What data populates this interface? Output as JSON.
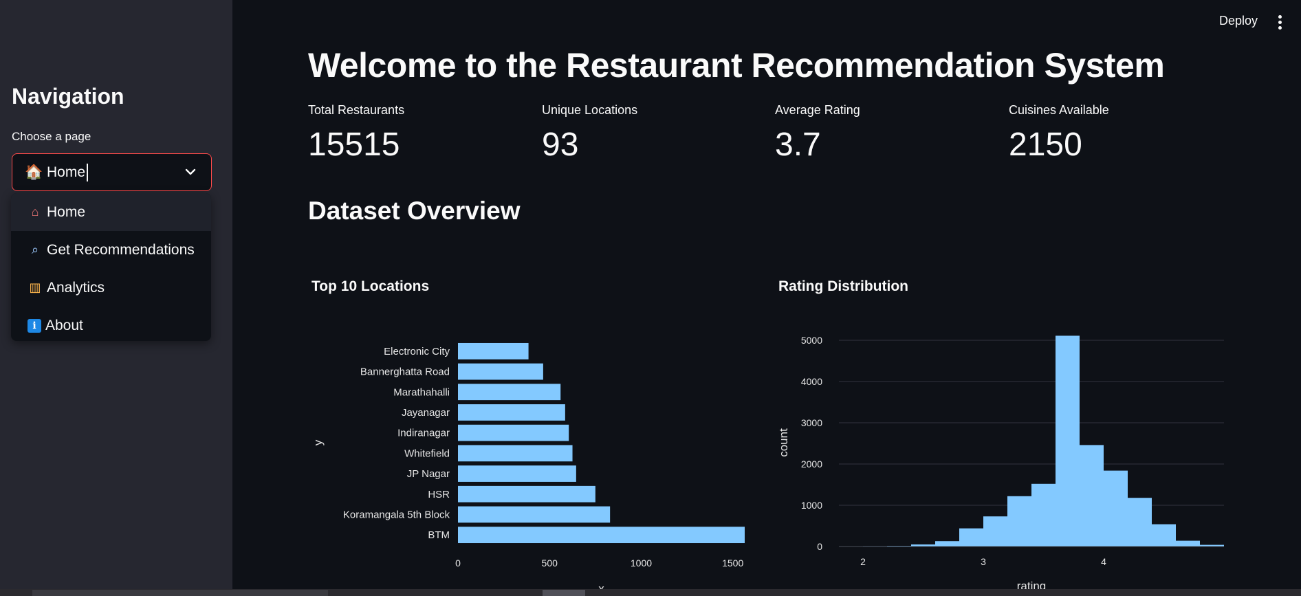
{
  "header": {
    "deploy_label": "Deploy"
  },
  "sidebar": {
    "title": "Navigation",
    "select_label": "Choose a page",
    "selected_value": "🏠 Home",
    "options": [
      {
        "icon": "house-icon",
        "label": "Home"
      },
      {
        "icon": "magnifier-icon",
        "label": "Get Recommendations"
      },
      {
        "icon": "bar-chart-icon",
        "label": "Analytics"
      },
      {
        "icon": "info-icon",
        "label": "About"
      }
    ]
  },
  "main": {
    "title": "Welcome to the Restaurant Recommendation System",
    "metrics": [
      {
        "label": "Total Restaurants",
        "value": "15515"
      },
      {
        "label": "Unique Locations",
        "value": "93"
      },
      {
        "label": "Average Rating",
        "value": "3.7"
      },
      {
        "label": "Cuisines Available",
        "value": "2150"
      }
    ],
    "section_title": "Dataset Overview"
  },
  "colors": {
    "accent": "#ff4b4b",
    "bar": "#83c9ff",
    "background": "#0e1117",
    "sidebar": "#262730"
  },
  "chart_data": [
    {
      "type": "bar",
      "orientation": "horizontal",
      "title": "Top 10 Locations",
      "xlabel": "x",
      "ylabel": "y",
      "categories": [
        "Electronic City",
        "Bannerghatta Road",
        "Marathahalli",
        "Jayanagar",
        "Indiranagar",
        "Whitefield",
        "JP Nagar",
        "HSR",
        "Koramangala 5th Block",
        "BTM"
      ],
      "values": [
        385,
        465,
        560,
        585,
        605,
        625,
        645,
        750,
        830,
        1565
      ],
      "xticks": [
        0,
        500,
        1000,
        1500
      ],
      "xlim": [
        0,
        1565
      ],
      "grid": false
    },
    {
      "type": "bar",
      "subtype": "histogram",
      "title": "Rating Distribution",
      "xlabel": "rating",
      "ylabel": "count",
      "bins": [
        {
          "x0": 1.8,
          "x1": 2.0,
          "count": 5
        },
        {
          "x0": 2.0,
          "x1": 2.2,
          "count": 10
        },
        {
          "x0": 2.2,
          "x1": 2.4,
          "count": 15
        },
        {
          "x0": 2.4,
          "x1": 2.6,
          "count": 50
        },
        {
          "x0": 2.6,
          "x1": 2.8,
          "count": 130
        },
        {
          "x0": 2.8,
          "x1": 3.0,
          "count": 440
        },
        {
          "x0": 3.0,
          "x1": 3.2,
          "count": 730
        },
        {
          "x0": 3.2,
          "x1": 3.4,
          "count": 1220
        },
        {
          "x0": 3.4,
          "x1": 3.6,
          "count": 1520
        },
        {
          "x0": 3.6,
          "x1": 3.8,
          "count": 5110
        },
        {
          "x0": 3.8,
          "x1": 4.0,
          "count": 2460
        },
        {
          "x0": 4.0,
          "x1": 4.2,
          "count": 1840
        },
        {
          "x0": 4.2,
          "x1": 4.4,
          "count": 1180
        },
        {
          "x0": 4.4,
          "x1": 4.6,
          "count": 540
        },
        {
          "x0": 4.6,
          "x1": 4.8,
          "count": 140
        },
        {
          "x0": 4.8,
          "x1": 5.0,
          "count": 40
        }
      ],
      "xticks": [
        2,
        3,
        4
      ],
      "yticks": [
        0,
        1000,
        2000,
        3000,
        4000,
        5000
      ],
      "xlim": [
        1.8,
        5.0
      ],
      "ylim": [
        0,
        5250
      ],
      "grid": true
    }
  ]
}
